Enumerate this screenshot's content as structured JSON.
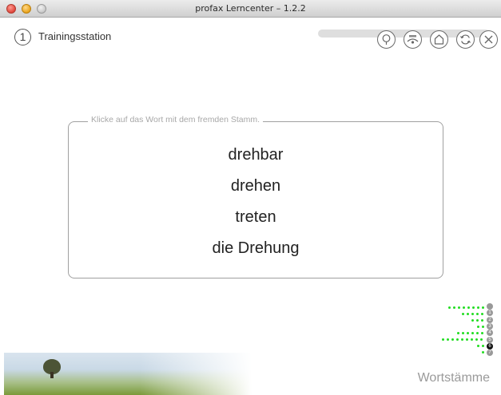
{
  "window": {
    "title": "profax Lerncenter – 1.2.2"
  },
  "header": {
    "station_number": "1",
    "station_label": "Trainingsstation"
  },
  "toolbar": {
    "buttons": [
      {
        "name": "hint-button",
        "icon": "lightbulb-icon"
      },
      {
        "name": "training-button",
        "icon": "training-icon"
      },
      {
        "name": "home-button",
        "icon": "home-icon"
      },
      {
        "name": "repeat-button",
        "icon": "refresh-icon"
      },
      {
        "name": "close-button",
        "icon": "close-icon"
      }
    ]
  },
  "task": {
    "instruction": "Klicke auf das Wort mit dem fremden Stamm.",
    "words": [
      "drehbar",
      "drehen",
      "treten",
      "die Drehung"
    ]
  },
  "levels": {
    "labels": [
      "",
      "1",
      "2",
      "3",
      "4",
      "5",
      "6",
      "7"
    ],
    "active_index": 6
  },
  "footer": {
    "topic": "Wortstämme"
  },
  "colors": {
    "dots": "#22dd22",
    "level_active": "#111111",
    "level_inactive": "#999999"
  }
}
